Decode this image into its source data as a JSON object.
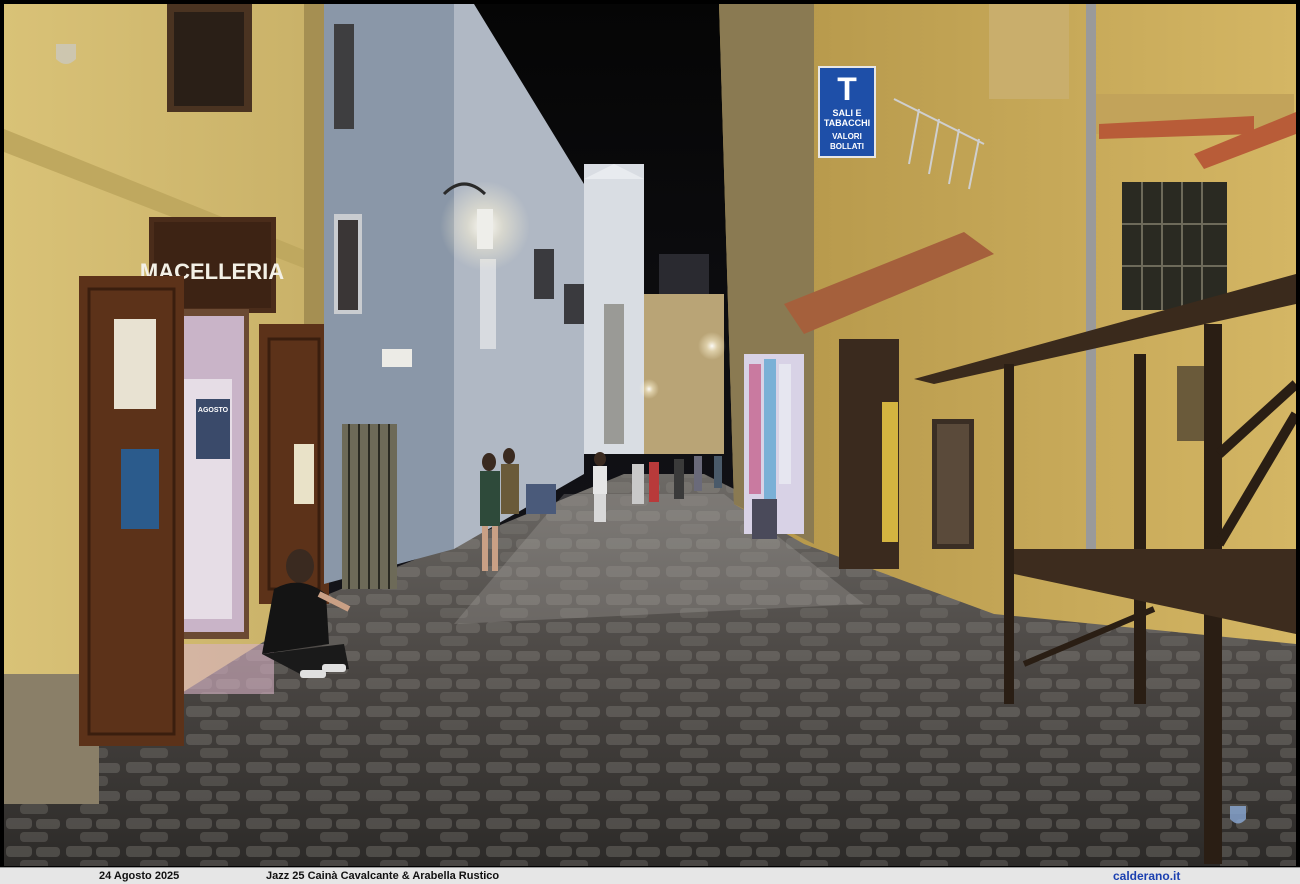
{
  "photo": {
    "shop_sign": "MACELLERIA",
    "tabacchi_sign": {
      "letter": "T",
      "line1": "SALI E",
      "line2": "TABACCHI",
      "line3": "VALORI",
      "line4": "BOLLATI"
    },
    "poster_lines": [
      "AGOSTO"
    ]
  },
  "caption": {
    "date": "24 Agosto 2025",
    "title": "Jazz 25 Cainà Cavalcante & Arabella Rustico",
    "site": "calderano.it"
  }
}
